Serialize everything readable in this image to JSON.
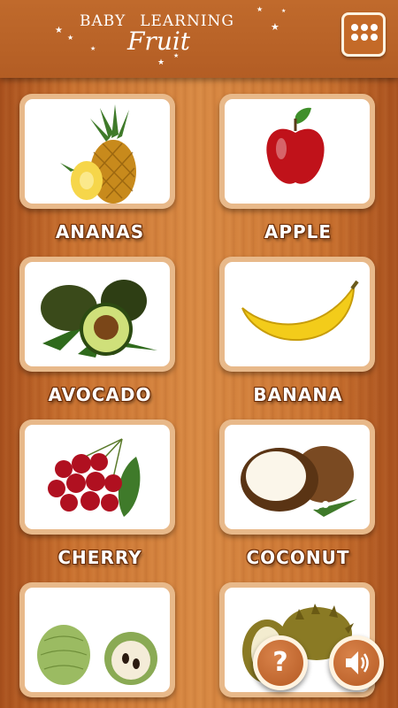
{
  "header": {
    "title_word1": "BABY",
    "title_word2": "LEARNING",
    "title_script": "Fruit",
    "menu_icon": "grid-menu-icon"
  },
  "fruits": [
    {
      "label": "ANANAS",
      "icon": "pineapple-image"
    },
    {
      "label": "APPLE",
      "icon": "apple-image"
    },
    {
      "label": "AVOCADO",
      "icon": "avocado-image"
    },
    {
      "label": "BANANA",
      "icon": "banana-image"
    },
    {
      "label": "CHERRY",
      "icon": "cherry-image"
    },
    {
      "label": "COCONUT",
      "icon": "coconut-image"
    },
    {
      "label": "",
      "icon": "custard-apple-image"
    },
    {
      "label": "",
      "icon": "durian-image"
    }
  ],
  "floating_buttons": {
    "help_glyph": "?",
    "help_icon": "question-icon",
    "sound_icon": "speaker-icon"
  },
  "colors": {
    "accent": "#c46a28",
    "label_outline": "#6b2d08"
  }
}
